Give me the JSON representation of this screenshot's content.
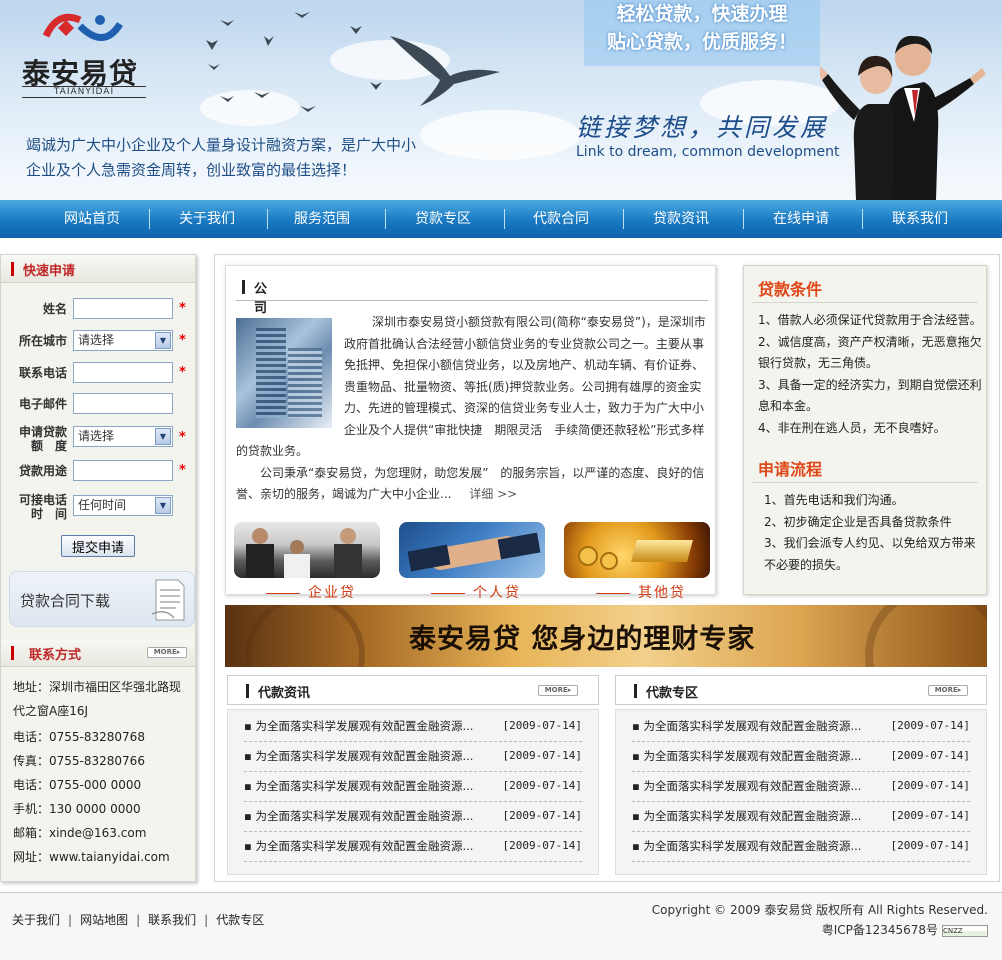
{
  "header": {
    "logo_cn": "泰安易贷",
    "logo_en": "TAIANYIDAI",
    "slogan_line1": "轻松贷款，快速办理",
    "slogan_line2": "贴心贷款，优质服务！",
    "tagline_cn": "链接梦想，共同发展",
    "tagline_en": "Link to dream, common development",
    "description": "竭诚为广大中小企业及个人量身设计融资方案，是广大中小企业及个人急需资金周转，创业致富的最佳选择！"
  },
  "nav": {
    "items": [
      "网站首页",
      "关于我们",
      "服务范围",
      "贷款专区",
      "代款合同",
      "贷款资讯",
      "在线申请",
      "联系我们"
    ]
  },
  "quick_apply": {
    "title": "快速申请",
    "fields": {
      "name": "姓名",
      "city": "所在城市",
      "phone": "联系电话",
      "email": "电子邮件",
      "amount_l1": "申请贷款",
      "amount_l2": "额　度",
      "purpose": "贷款用途",
      "time_l1": "可接电话",
      "time_l2": "时　间"
    },
    "city_value": "请选择",
    "amount_value": "请选择",
    "time_value": "任何时间",
    "required_mark": "*",
    "submit": "提交申请",
    "download": "贷款合同下载"
  },
  "contact": {
    "title": "联系方式",
    "more": "MORE▸",
    "address_l1": "地址：深圳市福田区华强北路现",
    "address_l2": "代之窗A座16J",
    "phone1": "电话：0755-83280768",
    "fax": "传真：0755-83280766",
    "phone2": "电话：0755-000 0000",
    "mobile": "手机：130 0000 0000",
    "email": "邮箱：xinde@163.com",
    "website": "网址：www.taianyidai.com"
  },
  "intro": {
    "title": "公司简介",
    "text": "深圳市泰安易贷小额贷款有限公司(简称“泰安易贷”)，是深圳市政府首批确认合法经营小额信贷业务的专业贷款公司之一。主要从事免抵押、免担保小额信贷业务，以及房地产、机动车辆、有价证券、贵重物品、批量物资、等抵(质)押贷款业务。公司拥有雄厚的资金实力、先进的管理模式、资深的信贷业务专业人士，致力于为广大中小企业及个人提供“审批快捷　期限灵活　手续简便还款轻松”形式多样的贷款业务。",
    "text2": "公司秉承“泰安易贷，为您理财，助您发展”　的服务宗旨，以严谨的态度、良好的信誉、亲切的服务，竭诚为广大中小企业...",
    "more": "详细 >>",
    "tiles": [
      "企业贷",
      "个人贷",
      "其他贷"
    ]
  },
  "conditions": {
    "title": "贷款条件",
    "items": [
      "1、借款人必须保证代贷款用于合法经营。",
      "2、诚信度高，资产产权清晰，无恶意拖欠银行贷款，无三角债。",
      "3、具备一定的经济实力，到期自觉偿还利息和本金。",
      "4、非在刑在逃人员，无不良嗜好。"
    ],
    "process_title": "申请流程",
    "process": [
      "1、首先电话和我们沟通。",
      "2、初步确定企业是否具备贷款条件",
      "3、我们会派专人约见、以免给双方带来不必要的损失。"
    ]
  },
  "banner": {
    "text": "泰安易贷  您身边的理财专家"
  },
  "news_left": {
    "title": "代款资讯",
    "more": "MORE▸",
    "rows": [
      {
        "title": "为全面落实科学发展观有效配置金融资源...",
        "date": "[2009-07-14]"
      },
      {
        "title": "为全面落实科学发展观有效配置金融资源...",
        "date": "[2009-07-14]"
      },
      {
        "title": "为全面落实科学发展观有效配置金融资源...",
        "date": "[2009-07-14]"
      },
      {
        "title": "为全面落实科学发展观有效配置金融资源...",
        "date": "[2009-07-14]"
      },
      {
        "title": "为全面落实科学发展观有效配置金融资源...",
        "date": "[2009-07-14]"
      }
    ]
  },
  "news_right": {
    "title": "代款专区",
    "more": "MORE▸",
    "rows": [
      {
        "title": "为全面落实科学发展观有效配置金融资源...",
        "date": "[2009-07-14]"
      },
      {
        "title": "为全面落实科学发展观有效配置金融资源...",
        "date": "[2009-07-14]"
      },
      {
        "title": "为全面落实科学发展观有效配置金融资源...",
        "date": "[2009-07-14]"
      },
      {
        "title": "为全面落实科学发展观有效配置金融资源...",
        "date": "[2009-07-14]"
      },
      {
        "title": "为全面落实科学发展观有效配置金融资源...",
        "date": "[2009-07-14]"
      }
    ]
  },
  "footer": {
    "links": [
      "关于我们",
      "网站地图",
      "联系我们",
      "代款专区"
    ],
    "copyright": "Copyright © 2009 泰安易贷 版权所有 All Rights Reserved.",
    "icp": "粤ICP备12345678号",
    "badge": "CNZZ"
  },
  "colors": {
    "nav": "#1979c2",
    "accent_red": "#c0282a",
    "orange_title": "#e04718"
  }
}
